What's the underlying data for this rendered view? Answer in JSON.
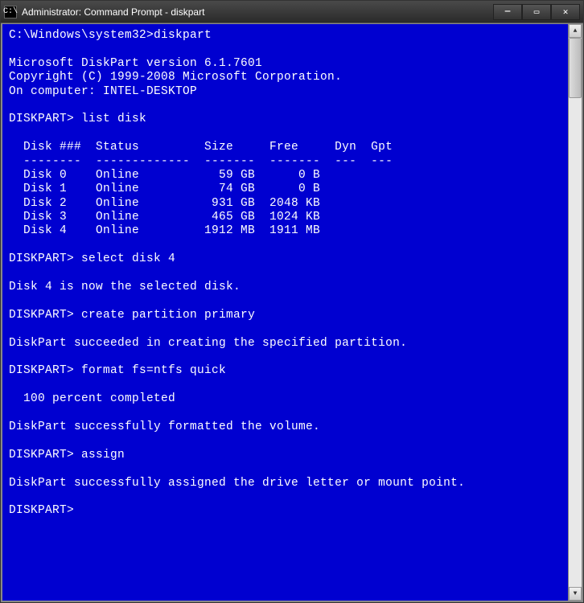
{
  "window": {
    "title": "Administrator: Command Prompt - diskpart",
    "icon_glyph": "C:\\"
  },
  "initial_prompt": "C:\\Windows\\system32>",
  "initial_command": "diskpart",
  "header": {
    "version_line": "Microsoft DiskPart version 6.1.7601",
    "copyright_line": "Copyright (C) 1999-2008 Microsoft Corporation.",
    "computer_line": "On computer: INTEL-DESKTOP"
  },
  "prompt": "DISKPART>",
  "commands": {
    "list_disk": "list disk",
    "select_disk": "select disk 4",
    "create_partition": "create partition primary",
    "format": "format fs=ntfs quick",
    "assign": "assign"
  },
  "table": {
    "header": "  Disk ###  Status         Size     Free     Dyn  Gpt",
    "divider": "  --------  -------------  -------  -------  ---  ---",
    "rows": [
      "  Disk 0    Online           59 GB      0 B",
      "  Disk 1    Online           74 GB      0 B",
      "  Disk 2    Online          931 GB  2048 KB",
      "  Disk 3    Online          465 GB  1024 KB",
      "  Disk 4    Online         1912 MB  1911 MB"
    ]
  },
  "messages": {
    "selected": "Disk 4 is now the selected disk.",
    "created": "DiskPart succeeded in creating the specified partition.",
    "progress": "  100 percent completed",
    "formatted": "DiskPart successfully formatted the volume.",
    "assigned": "DiskPart successfully assigned the drive letter or mount point."
  },
  "scrollbar": {
    "up_glyph": "▲",
    "down_glyph": "▼"
  },
  "titlebar_buttons": {
    "minimize": "—",
    "maximize": "▭",
    "close": "✕"
  }
}
